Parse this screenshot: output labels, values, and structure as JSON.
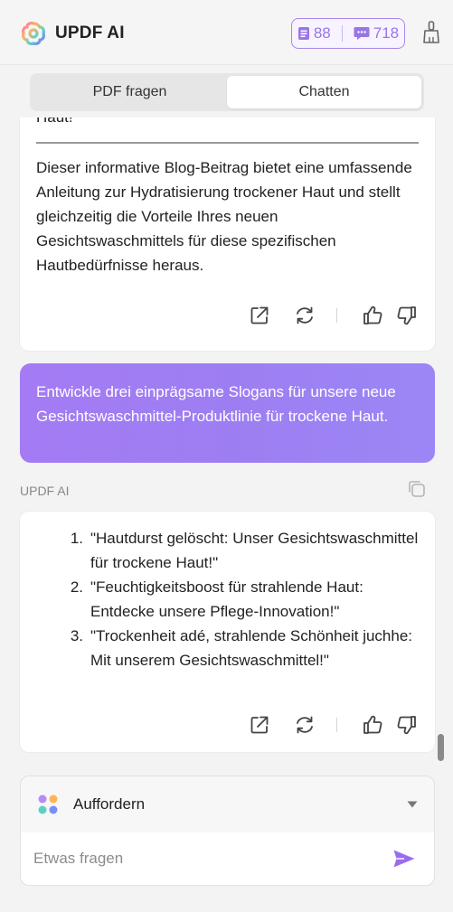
{
  "header": {
    "app_title": "UPDF AI",
    "pdf_quota": "88",
    "chat_quota": "718",
    "accent_color": "#9a75e6"
  },
  "tabs": [
    {
      "label": "PDF fragen",
      "active": false
    },
    {
      "label": "Chatten",
      "active": true
    }
  ],
  "messages": {
    "ai_previous": {
      "partial_line": "Haut!",
      "paragraph": "Dieser informative Blog-Beitrag bietet eine umfassende Anleitung zur Hydratisierung trockener Haut und stellt gleichzeitig die Vorteile Ihres neuen Gesichtswaschmittels für diese spezifischen Hautbedürfnisse heraus."
    },
    "user": {
      "text": "Entwickle drei einprägsame Slogans für unsere neue Gesichtswaschmittel-Produktlinie für trockene Haut."
    },
    "ai_label": "UPDF AI",
    "ai_reply": {
      "items": [
        {
          "num": "1.",
          "text": "\"Hautdurst gelöscht: Unser Gesichtswaschmittel für trockene Haut!\""
        },
        {
          "num": "2.",
          "text": "\"Feuchtigkeitsboost für strahlende Haut: Entdecke unsere Pflege-Innovation!\""
        },
        {
          "num": "3.",
          "text": "\"Trockenheit adé, strahlende Schönheit juchhe: Mit unserem Gesichtswaschmittel!\""
        }
      ]
    }
  },
  "composer": {
    "prompt_label": "Auffordern",
    "placeholder": "Etwas fragen",
    "value": ""
  },
  "icons": {
    "logo": "updf-logo-icon",
    "pdf_quota": "document-icon",
    "chat_quota": "chat-bubble-icon",
    "clear": "broom-icon",
    "copy": "copy-icon",
    "share": "share-icon",
    "regenerate": "regenerate-icon",
    "like": "thumbs-up-icon",
    "dislike": "thumbs-down-icon",
    "prompt": "prompt-dots-icon",
    "send": "send-icon"
  }
}
